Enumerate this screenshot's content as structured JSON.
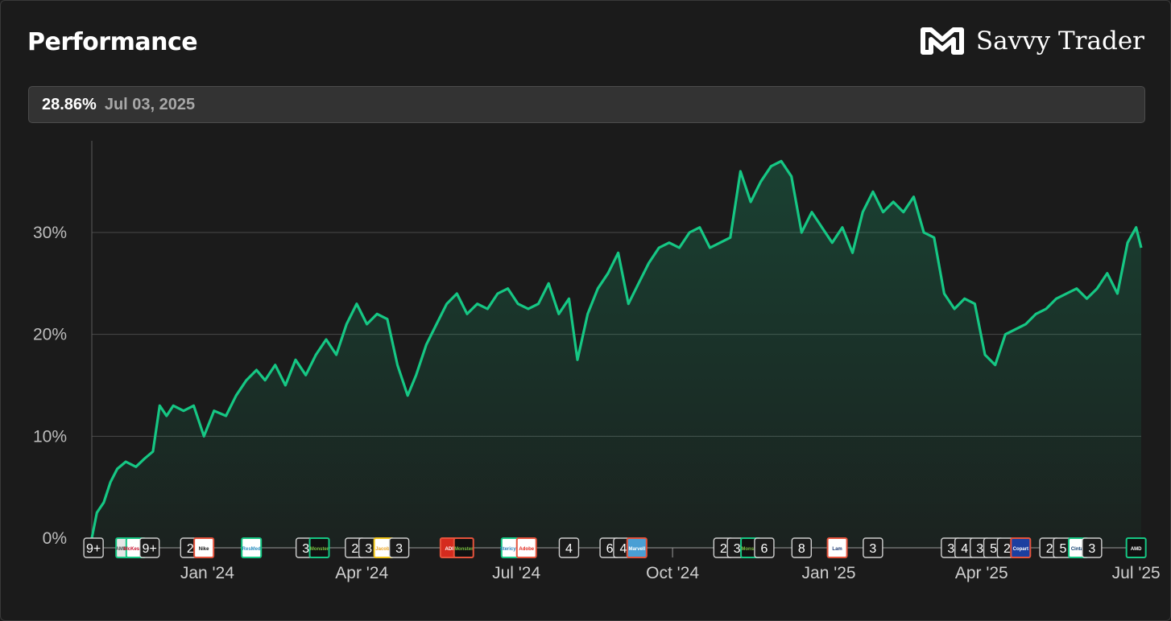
{
  "header": {
    "title": "Performance"
  },
  "brand": {
    "name": "Savvy Trader"
  },
  "readout": {
    "value": "28.86%",
    "date": "Jul 03, 2025"
  },
  "colors": {
    "line": "#16c784",
    "background": "#1b1b1b",
    "grid": "#4a4a4a"
  },
  "chart_data": {
    "type": "area",
    "title": "",
    "xlabel": "",
    "ylabel": "",
    "ylim": [
      0,
      39
    ],
    "y_ticks": [
      {
        "value": 0,
        "label": "0%"
      },
      {
        "value": 10,
        "label": "10%"
      },
      {
        "value": 20,
        "label": "20%"
      },
      {
        "value": 30,
        "label": "30%"
      }
    ],
    "x_ticks": [
      {
        "date": "2024-01-01",
        "label": "Jan '24"
      },
      {
        "date": "2024-04-01",
        "label": "Apr '24"
      },
      {
        "date": "2024-07-01",
        "label": "Jul '24"
      },
      {
        "date": "2024-10-01",
        "label": "Oct '24"
      },
      {
        "date": "2025-01-01",
        "label": "Jan '25"
      },
      {
        "date": "2025-04-01",
        "label": "Apr '25"
      },
      {
        "date": "2025-07-01",
        "label": "Jul '25"
      }
    ],
    "xlim": [
      "2023-10-25",
      "2025-07-04"
    ],
    "grid": true,
    "series": [
      {
        "values": [
          [
            "2023-10-25",
            0.0
          ],
          [
            "2023-10-28",
            2.5
          ],
          [
            "2023-11-01",
            3.5
          ],
          [
            "2023-11-05",
            5.5
          ],
          [
            "2023-11-09",
            6.8
          ],
          [
            "2023-11-14",
            7.5
          ],
          [
            "2023-11-20",
            7.0
          ],
          [
            "2023-11-25",
            7.8
          ],
          [
            "2023-11-30",
            8.5
          ],
          [
            "2023-12-04",
            13.0
          ],
          [
            "2023-12-08",
            12.0
          ],
          [
            "2023-12-12",
            13.0
          ],
          [
            "2023-12-18",
            12.5
          ],
          [
            "2023-12-24",
            13.0
          ],
          [
            "2023-12-30",
            10.0
          ],
          [
            "2024-01-05",
            12.5
          ],
          [
            "2024-01-12",
            12.0
          ],
          [
            "2024-01-18",
            14.0
          ],
          [
            "2024-01-24",
            15.5
          ],
          [
            "2024-01-30",
            16.5
          ],
          [
            "2024-02-04",
            15.5
          ],
          [
            "2024-02-10",
            17.0
          ],
          [
            "2024-02-16",
            15.0
          ],
          [
            "2024-02-22",
            17.5
          ],
          [
            "2024-02-28",
            16.0
          ],
          [
            "2024-03-05",
            18.0
          ],
          [
            "2024-03-11",
            19.5
          ],
          [
            "2024-03-17",
            18.0
          ],
          [
            "2024-03-23",
            21.0
          ],
          [
            "2024-03-29",
            23.0
          ],
          [
            "2024-04-04",
            21.0
          ],
          [
            "2024-04-10",
            22.0
          ],
          [
            "2024-04-16",
            21.5
          ],
          [
            "2024-04-22",
            17.0
          ],
          [
            "2024-04-28",
            14.0
          ],
          [
            "2024-05-03",
            16.0
          ],
          [
            "2024-05-09",
            19.0
          ],
          [
            "2024-05-15",
            21.0
          ],
          [
            "2024-05-21",
            23.0
          ],
          [
            "2024-05-27",
            24.0
          ],
          [
            "2024-06-02",
            22.0
          ],
          [
            "2024-06-08",
            23.0
          ],
          [
            "2024-06-14",
            22.5
          ],
          [
            "2024-06-20",
            24.0
          ],
          [
            "2024-06-26",
            24.5
          ],
          [
            "2024-07-02",
            23.0
          ],
          [
            "2024-07-08",
            22.5
          ],
          [
            "2024-07-14",
            23.0
          ],
          [
            "2024-07-20",
            25.0
          ],
          [
            "2024-07-26",
            22.0
          ],
          [
            "2024-08-01",
            23.5
          ],
          [
            "2024-08-06",
            17.5
          ],
          [
            "2024-08-12",
            22.0
          ],
          [
            "2024-08-18",
            24.5
          ],
          [
            "2024-08-24",
            26.0
          ],
          [
            "2024-08-30",
            28.0
          ],
          [
            "2024-09-05",
            23.0
          ],
          [
            "2024-09-11",
            25.0
          ],
          [
            "2024-09-17",
            27.0
          ],
          [
            "2024-09-23",
            28.5
          ],
          [
            "2024-09-29",
            29.0
          ],
          [
            "2024-10-05",
            28.5
          ],
          [
            "2024-10-11",
            30.0
          ],
          [
            "2024-10-17",
            30.5
          ],
          [
            "2024-10-23",
            28.5
          ],
          [
            "2024-10-29",
            29.0
          ],
          [
            "2024-11-04",
            29.5
          ],
          [
            "2024-11-10",
            36.0
          ],
          [
            "2024-11-16",
            33.0
          ],
          [
            "2024-11-22",
            35.0
          ],
          [
            "2024-11-28",
            36.5
          ],
          [
            "2024-12-04",
            37.0
          ],
          [
            "2024-12-10",
            35.5
          ],
          [
            "2024-12-16",
            30.0
          ],
          [
            "2024-12-22",
            32.0
          ],
          [
            "2024-12-28",
            30.5
          ],
          [
            "2025-01-03",
            29.0
          ],
          [
            "2025-01-09",
            30.5
          ],
          [
            "2025-01-15",
            28.0
          ],
          [
            "2025-01-21",
            32.0
          ],
          [
            "2025-01-27",
            34.0
          ],
          [
            "2025-02-02",
            32.0
          ],
          [
            "2025-02-08",
            33.0
          ],
          [
            "2025-02-14",
            32.0
          ],
          [
            "2025-02-20",
            33.5
          ],
          [
            "2025-02-26",
            30.0
          ],
          [
            "2025-03-04",
            29.5
          ],
          [
            "2025-03-10",
            24.0
          ],
          [
            "2025-03-16",
            22.5
          ],
          [
            "2025-03-22",
            23.5
          ],
          [
            "2025-03-28",
            23.0
          ],
          [
            "2025-04-03",
            18.0
          ],
          [
            "2025-04-09",
            17.0
          ],
          [
            "2025-04-15",
            20.0
          ],
          [
            "2025-04-21",
            20.5
          ],
          [
            "2025-04-27",
            21.0
          ],
          [
            "2025-05-03",
            22.0
          ],
          [
            "2025-05-09",
            22.5
          ],
          [
            "2025-05-15",
            23.5
          ],
          [
            "2025-05-21",
            24.0
          ],
          [
            "2025-05-27",
            24.5
          ],
          [
            "2025-06-02",
            23.5
          ],
          [
            "2025-06-08",
            24.5
          ],
          [
            "2025-06-14",
            26.0
          ],
          [
            "2025-06-20",
            24.0
          ],
          [
            "2025-06-26",
            29.0
          ],
          [
            "2025-07-01",
            30.5
          ],
          [
            "2025-07-04",
            28.5
          ]
        ]
      }
    ],
    "event_markers": [
      {
        "date": "2023-10-26",
        "kind": "count",
        "label": "9+"
      },
      {
        "date": "2023-11-14",
        "kind": "logo",
        "label": "AMETEK",
        "border": "#16c784",
        "fill": "#e6e6e6",
        "ink": "#444444"
      },
      {
        "date": "2023-11-20",
        "kind": "logo",
        "label": "McKesson",
        "border": "#16c784",
        "fill": "#ffffff",
        "ink": "#c8102e"
      },
      {
        "date": "2023-11-28",
        "kind": "count",
        "label": "9+"
      },
      {
        "date": "2023-12-22",
        "kind": "count",
        "label": "2"
      },
      {
        "date": "2023-12-30",
        "kind": "logo",
        "label": "Nike",
        "border": "#e5533c",
        "fill": "#ffffff",
        "ink": "#111111"
      },
      {
        "date": "2024-01-27",
        "kind": "logo",
        "label": "ResMed",
        "border": "#16c784",
        "fill": "#ffffff",
        "ink": "#2a8fbf"
      },
      {
        "date": "2024-02-28",
        "kind": "count",
        "label": "3"
      },
      {
        "date": "2024-03-07",
        "kind": "logo",
        "label": "Monster",
        "border": "#16c784",
        "fill": "#111111",
        "ink": "#7cc242"
      },
      {
        "date": "2024-03-28",
        "kind": "count",
        "label": "2"
      },
      {
        "date": "2024-04-05",
        "kind": "count",
        "label": "3"
      },
      {
        "date": "2024-04-14",
        "kind": "logo",
        "label": "Jacobs",
        "border": "#f0c419",
        "fill": "#ffffff",
        "ink": "#e9a11c"
      },
      {
        "date": "2024-04-23",
        "kind": "count",
        "label": "3"
      },
      {
        "date": "2024-05-23",
        "kind": "logo",
        "label": "ADP",
        "border": "#e5533c",
        "fill": "#d52b1e",
        "ink": "#ffffff"
      },
      {
        "date": "2024-05-31",
        "kind": "logo",
        "label": "Monster",
        "border": "#e5533c",
        "fill": "#111111",
        "ink": "#7cc242"
      },
      {
        "date": "2024-06-28",
        "kind": "logo",
        "label": "Stericycle",
        "border": "#16c784",
        "fill": "#ffffff",
        "ink": "#2a7fb8"
      },
      {
        "date": "2024-07-07",
        "kind": "logo",
        "label": "Adobe",
        "border": "#e5533c",
        "fill": "#ffffff",
        "ink": "#e1251b"
      },
      {
        "date": "2024-08-01",
        "kind": "count",
        "label": "4"
      },
      {
        "date": "2024-08-25",
        "kind": "count",
        "label": "6"
      },
      {
        "date": "2024-09-02",
        "kind": "count",
        "label": "4"
      },
      {
        "date": "2024-09-10",
        "kind": "logo",
        "label": "Marvell",
        "border": "#e5533c",
        "fill": "#4a9fd4",
        "ink": "#ffffff"
      },
      {
        "date": "2024-10-31",
        "kind": "count",
        "label": "2"
      },
      {
        "date": "2024-11-08",
        "kind": "count",
        "label": "3"
      },
      {
        "date": "2024-11-16",
        "kind": "logo",
        "label": "Monster",
        "border": "#16c784",
        "fill": "#111111",
        "ink": "#7cc242"
      },
      {
        "date": "2024-11-24",
        "kind": "count",
        "label": "6"
      },
      {
        "date": "2024-12-16",
        "kind": "count",
        "label": "8"
      },
      {
        "date": "2025-01-06",
        "kind": "logo",
        "label": "Lam",
        "border": "#e5533c",
        "fill": "#ffffff",
        "ink": "#1f3b73"
      },
      {
        "date": "2025-01-27",
        "kind": "count",
        "label": "3"
      },
      {
        "date": "2025-03-14",
        "kind": "count",
        "label": "3"
      },
      {
        "date": "2025-03-22",
        "kind": "count",
        "label": "4"
      },
      {
        "date": "2025-03-31",
        "kind": "count",
        "label": "3"
      },
      {
        "date": "2025-04-08",
        "kind": "count",
        "label": "5"
      },
      {
        "date": "2025-04-16",
        "kind": "count",
        "label": "2"
      },
      {
        "date": "2025-04-24",
        "kind": "logo",
        "label": "Copart",
        "border": "#e5533c",
        "fill": "#1c3fa0",
        "ink": "#ffffff"
      },
      {
        "date": "2025-05-11",
        "kind": "count",
        "label": "2"
      },
      {
        "date": "2025-05-19",
        "kind": "count",
        "label": "5"
      },
      {
        "date": "2025-05-28",
        "kind": "logo",
        "label": "Cintas",
        "border": "#16c784",
        "fill": "#ffffff",
        "ink": "#0a3a6b"
      },
      {
        "date": "2025-06-05",
        "kind": "count",
        "label": "3"
      },
      {
        "date": "2025-07-01",
        "kind": "logo",
        "label": "AMD",
        "border": "#16c784",
        "fill": "#111111",
        "ink": "#ffffff"
      }
    ]
  }
}
